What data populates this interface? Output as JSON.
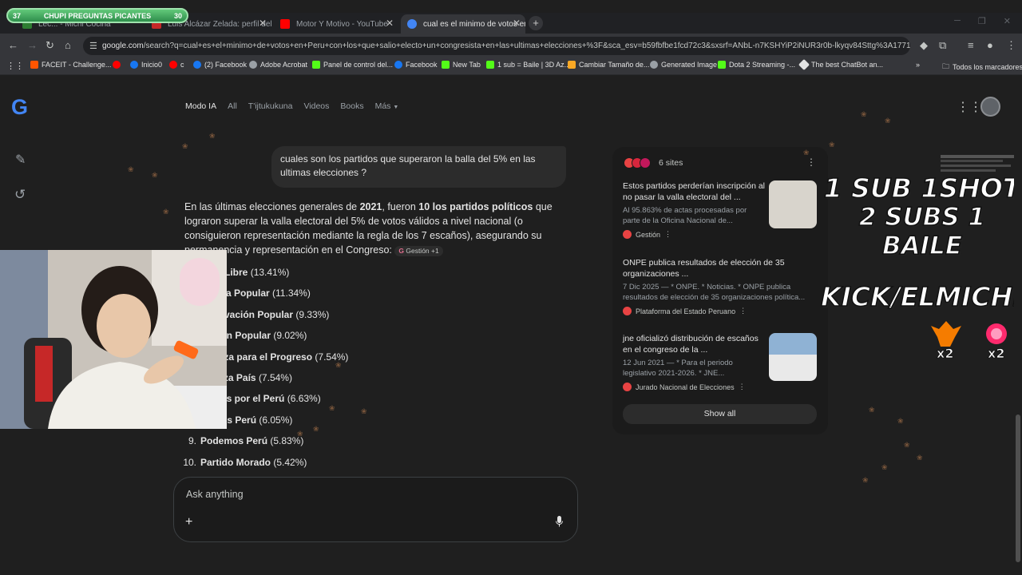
{
  "overlay": {
    "left_value": "37",
    "title": "CHUPI PREGUNTAS PICANTES",
    "right_value": "30",
    "text_line1": "1 SUB  1SHOT",
    "text_line2": "2 SUBS 1 BAILE",
    "kick": "KICK/ELMICHIJ",
    "mult_left": "x2",
    "mult_right": "x2"
  },
  "tabs": [
    {
      "label": "Lec... - Michi Cocina",
      "color": "#2e7d32"
    },
    {
      "label": "Luis Alcázar Zelada: perfil del …",
      "color": "#c62828"
    },
    {
      "label": "Motor Y Motivo - YouTube",
      "color": "#ff0000"
    },
    {
      "label": "cual es el minimo de votos en P",
      "color": "#4285f4"
    }
  ],
  "address": {
    "host": "google.com",
    "path": "/search?q=cual+es+el+minimo+de+votos+en+Peru+con+los+que+salio+electo+un+congresista+en+las+ultimas+elecciones+%3F&sca_esv=b59fbfbe1fcd72c3&sxsrf=ANbL-n7KSHYiP2iNUR3r0b-lkyqv84Sttg%3A17715..."
  },
  "bookmarks": [
    {
      "label": "FACEIT - Challenge...",
      "color": "#ff5500"
    },
    {
      "label": "",
      "color": "#ff0000"
    },
    {
      "label": "Inicio0",
      "color": "#1877f2"
    },
    {
      "label": "c",
      "color": "#ff0000"
    },
    {
      "label": "(2) Facebook",
      "color": "#1877f2"
    },
    {
      "label": "Adobe Acrobat",
      "color": "#9aa0a6"
    },
    {
      "label": "Panel de control del...",
      "color": "#53fc18"
    },
    {
      "label": "Facebook",
      "color": "#1877f2"
    },
    {
      "label": "New Tab",
      "color": "#53fc18"
    },
    {
      "label": "1 sub = Baile | 3D Az...",
      "color": "#53fc18"
    },
    {
      "label": "Cambiar Tamaño de...",
      "color": "#f9a825"
    },
    {
      "label": "Generated Image",
      "color": "#9aa0a6"
    },
    {
      "label": "Dota 2 Streaming -...",
      "color": "#53fc18"
    },
    {
      "label": "The best ChatBot an...",
      "color": "#e3e3e3"
    }
  ],
  "all_bookmarks": "Todos los marcadores",
  "search_tabs": [
    "Modo IA",
    "All",
    "T'ijtukukuna",
    "Videos",
    "Books",
    "Más"
  ],
  "user_question": "cuales son los partidos que superaron la balla del 5% en las ultimas elecciones ?",
  "answer": {
    "p1_before": "En las últimas elecciones generales de ",
    "p1_year": "2021",
    "p1_mid": ", fueron ",
    "p1_bold": "10 los partidos políticos",
    "p1_after": " que lograron superar la valla electoral del 5% de votos válidos a nivel nacional (o consiguieron representación mediante la regla de los 7 escaños), asegurando su permanencia y representación en el Congreso:",
    "cite": "Gestión +1"
  },
  "parties": [
    {
      "num": "1.",
      "name": "Perú Libre",
      "pct": "(13.41%)"
    },
    {
      "num": "2.",
      "name": "Fuerza Popular",
      "pct": "(11.34%)"
    },
    {
      "num": "3.",
      "name": "Renovación Popular",
      "pct": "(9.33%)"
    },
    {
      "num": "4.",
      "name": "Acción Popular",
      "pct": "(9.02%)"
    },
    {
      "num": "5.",
      "name": "Alianza para el Progreso",
      "pct": "(7.54%)"
    },
    {
      "num": "6.",
      "name": "Avanza País",
      "pct": "(7.54%)"
    },
    {
      "num": "7.",
      "name": "Juntos por el Perú",
      "pct": "(6.63%)"
    },
    {
      "num": "8.",
      "name": "Somos Perú",
      "pct": "(6.05%)"
    },
    {
      "num": "9.",
      "name": "Podemos Perú",
      "pct": "(5.83%)"
    },
    {
      "num": "10.",
      "name": "Partido Morado",
      "pct": "(5.42%)"
    }
  ],
  "chat": {
    "placeholder": "Ask anything"
  },
  "sources": {
    "count": "6 sites",
    "items": [
      {
        "title": "Estos partidos perderían inscripción al no pasar la valla electoral del ...",
        "snippet": "Al 95.863% de actas procesadas por parte de la Oficina Nacional de...",
        "publisher": "Gestión",
        "thumb": "#d8d4cc"
      },
      {
        "title": "ONPE publica resultados de elección de 35 organizaciones ...",
        "snippet": "7 Dic 2025 — * ONPE. * Noticias. * ONPE publica resultados de elección de 35 organizaciones política...",
        "publisher": "Plataforma del Estado Peruano",
        "thumb": ""
      },
      {
        "title": "jne oficializó distribución de escaños en el congreso de la ...",
        "snippet": "12 Jun 2021 — * Para el periodo legislativo 2021-2026. * JNE...",
        "publisher": "Jurado Nacional de Elecciones",
        "thumb": "#8fb2d4"
      }
    ],
    "show_all": "Show all"
  }
}
